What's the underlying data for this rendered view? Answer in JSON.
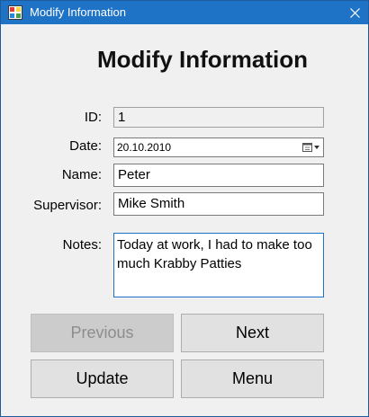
{
  "window": {
    "title": "Modify Information",
    "close_glyph": "✕"
  },
  "form": {
    "heading": "Modify Information",
    "id_label": "ID:",
    "id_value": "1",
    "date_label": "Date:",
    "date_value": "20.10.2010",
    "name_label": "Name:",
    "name_value": "Peter",
    "supervisor_label": "Supervisor:",
    "supervisor_value": "Mike Smith",
    "notes_label": "Notes:",
    "notes_value": "Today at work, I had to make too much Krabby Patties"
  },
  "buttons": {
    "previous": "Previous",
    "next": "Next",
    "update": "Update",
    "menu": "Menu"
  },
  "colors": {
    "titlebar": "#1f73c7",
    "window_bg": "#f0f0f0",
    "button_bg": "#e1e1e1",
    "button_disabled_bg": "#cccccc",
    "focus_border": "#1f73c7"
  },
  "icons": {
    "app": "app-form-icon",
    "close": "close-icon",
    "calendar": "calendar-dropdown-icon"
  }
}
